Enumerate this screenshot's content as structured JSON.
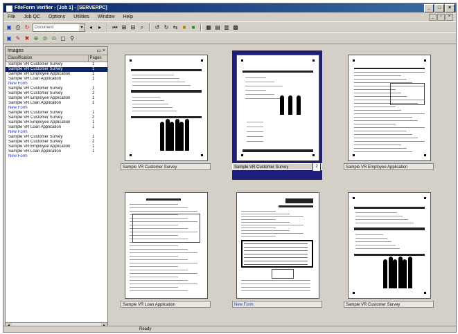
{
  "window": {
    "title": "FileForm Verifier - [Job 1] - [SERVERPC]"
  },
  "menu": [
    "File",
    "Job QC",
    "Options",
    "Utilities",
    "Window",
    "Help"
  ],
  "toolbar": {
    "combo_value": "Document"
  },
  "left_pane": {
    "title": "Images",
    "columns": {
      "classification": "Classification",
      "pages": "Pages"
    },
    "rows": [
      {
        "label": "Sample VR Customer Survey",
        "pages": "1",
        "type": "normal"
      },
      {
        "label": "Sample VR Customer Survey",
        "pages": "1",
        "type": "selected"
      },
      {
        "label": "Sample VR Employee Application",
        "pages": "1",
        "type": "normal"
      },
      {
        "label": "Sample VR Loan Application",
        "pages": "1",
        "type": "normal"
      },
      {
        "label": "New Form",
        "pages": "",
        "type": "newform"
      },
      {
        "label": "Sample VR Customer Survey",
        "pages": "1",
        "type": "normal"
      },
      {
        "label": "Sample VR Customer Survey",
        "pages": "2",
        "type": "normal"
      },
      {
        "label": "Sample VR Employee Application",
        "pages": "1",
        "type": "normal"
      },
      {
        "label": "Sample VR Loan Application",
        "pages": "1",
        "type": "normal"
      },
      {
        "label": "New Form",
        "pages": "",
        "type": "newform"
      },
      {
        "label": "Sample VR Customer Survey",
        "pages": "1",
        "type": "normal"
      },
      {
        "label": "Sample VR Customer Survey",
        "pages": "2",
        "type": "normal"
      },
      {
        "label": "Sample VR Employee Application",
        "pages": "1",
        "type": "normal"
      },
      {
        "label": "Sample VR Loan Application",
        "pages": "1",
        "type": "normal"
      },
      {
        "label": "New Form",
        "pages": "",
        "type": "newform"
      },
      {
        "label": "Sample VR Customer Survey",
        "pages": "1",
        "type": "normal"
      },
      {
        "label": "Sample VR Customer Survey",
        "pages": "2",
        "type": "normal"
      },
      {
        "label": "Sample VR Employee Application",
        "pages": "1",
        "type": "normal"
      },
      {
        "label": "Sample VR Loan Application",
        "pages": "1",
        "type": "normal"
      },
      {
        "label": "New Form",
        "pages": "",
        "type": "newform"
      }
    ]
  },
  "thumbnails": [
    {
      "caption": "Sample VR Customer Survey",
      "selected": false,
      "newform": false,
      "page_count": ""
    },
    {
      "caption": "Sample VR Customer Survey",
      "selected": true,
      "newform": false,
      "page_count": "2"
    },
    {
      "caption": "Sample VR Employee Application",
      "selected": false,
      "newform": false,
      "page_count": ""
    },
    {
      "caption": "Sample VR Loan Application",
      "selected": false,
      "newform": false,
      "page_count": ""
    },
    {
      "caption": "New Form",
      "selected": false,
      "newform": true,
      "page_count": ""
    },
    {
      "caption": "Sample VR Customer Survey",
      "selected": false,
      "newform": false,
      "page_count": ""
    }
  ],
  "status": {
    "text": "Ready"
  },
  "colors": {
    "title_bar": "#0a246a",
    "selection": "#1e1e7a",
    "new_form_text": "#2233cc"
  }
}
